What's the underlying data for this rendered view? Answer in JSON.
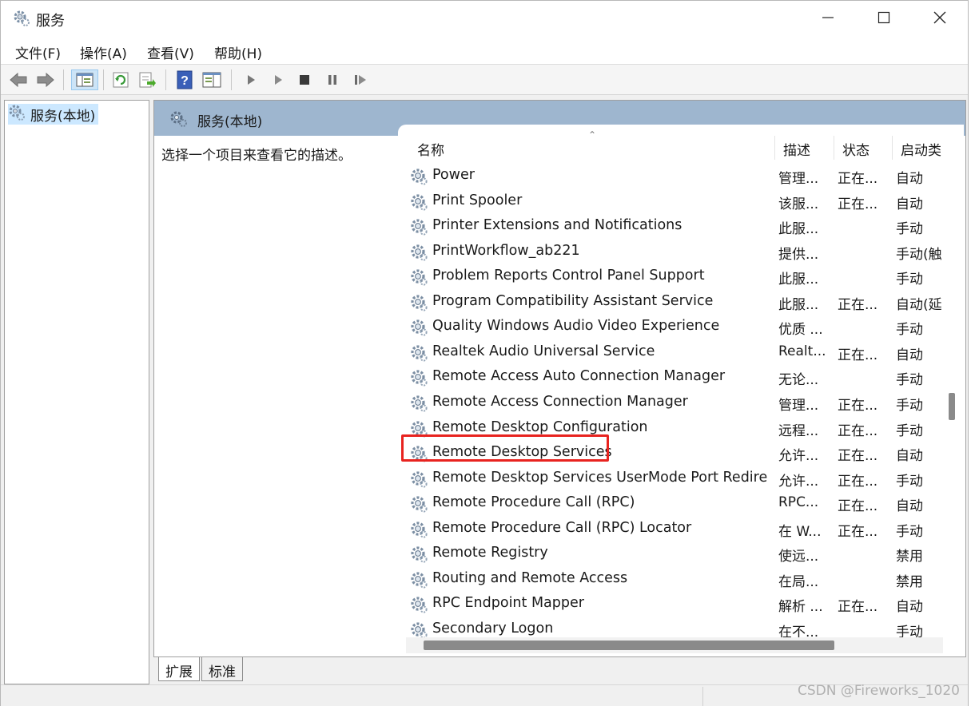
{
  "window": {
    "title": "服务",
    "controls": {
      "minimize": "minimize-icon",
      "maximize": "maximize-icon",
      "close": "close-icon"
    }
  },
  "menu": [
    "文件(F)",
    "操作(A)",
    "查看(V)",
    "帮助(H)"
  ],
  "toolbar": {
    "icons": [
      "back-arrow-icon",
      "forward-arrow-icon",
      "show-hide-console-tree-icon",
      "refresh-icon",
      "export-list-icon",
      "help-icon",
      "properties-icon",
      "start-service-icon",
      "start-service-alt-icon",
      "stop-service-icon",
      "pause-service-icon",
      "restart-service-icon"
    ]
  },
  "tree": {
    "root_label": "服务(本地)"
  },
  "panel": {
    "header_title": "服务(本地)",
    "description_hint": "选择一个项目来查看它的描述。"
  },
  "columns": {
    "name": "名称",
    "description": "描述",
    "status": "状态",
    "startup": "启动类"
  },
  "services": [
    {
      "name": "Power",
      "desc": "管理...",
      "status": "正在...",
      "startup": "自动"
    },
    {
      "name": "Print Spooler",
      "desc": "该服...",
      "status": "正在...",
      "startup": "自动"
    },
    {
      "name": "Printer Extensions and Notifications",
      "desc": "此服...",
      "status": "",
      "startup": "手动"
    },
    {
      "name": "PrintWorkflow_ab221",
      "desc": "提供...",
      "status": "",
      "startup": "手动(触"
    },
    {
      "name": "Problem Reports Control Panel Support",
      "desc": "此服...",
      "status": "",
      "startup": "手动"
    },
    {
      "name": "Program Compatibility Assistant Service",
      "desc": "此服...",
      "status": "正在...",
      "startup": "自动(延"
    },
    {
      "name": "Quality Windows Audio Video Experience",
      "desc": "优质 ...",
      "status": "",
      "startup": "手动"
    },
    {
      "name": "Realtek Audio Universal Service",
      "desc": "Realt...",
      "status": "正在...",
      "startup": "自动"
    },
    {
      "name": "Remote Access Auto Connection Manager",
      "desc": "无论...",
      "status": "",
      "startup": "手动"
    },
    {
      "name": "Remote Access Connection Manager",
      "desc": "管理...",
      "status": "正在...",
      "startup": "手动"
    },
    {
      "name": "Remote Desktop Configuration",
      "desc": "远程...",
      "status": "正在...",
      "startup": "手动"
    },
    {
      "name": "Remote Desktop Services",
      "desc": "允许...",
      "status": "正在...",
      "startup": "自动"
    },
    {
      "name": "Remote Desktop Services UserMode Port Redirec...",
      "desc": "允许...",
      "status": "正在...",
      "startup": "手动"
    },
    {
      "name": "Remote Procedure Call (RPC)",
      "desc": "RPC...",
      "status": "正在...",
      "startup": "自动"
    },
    {
      "name": "Remote Procedure Call (RPC) Locator",
      "desc": "在 W...",
      "status": "正在...",
      "startup": "手动"
    },
    {
      "name": "Remote Registry",
      "desc": "使远...",
      "status": "",
      "startup": "禁用"
    },
    {
      "name": "Routing and Remote Access",
      "desc": "在局...",
      "status": "",
      "startup": "禁用"
    },
    {
      "name": "RPC Endpoint Mapper",
      "desc": "解析 ...",
      "status": "正在...",
      "startup": "自动"
    },
    {
      "name": "Secondary Logon",
      "desc": "在不...",
      "status": "",
      "startup": "手动"
    }
  ],
  "highlighted_service": "Remote Desktop Services",
  "highlight_color": "#e8231f",
  "tabs": [
    "扩展",
    "标准"
  ],
  "watermark": "CSDN @Fireworks_1020"
}
